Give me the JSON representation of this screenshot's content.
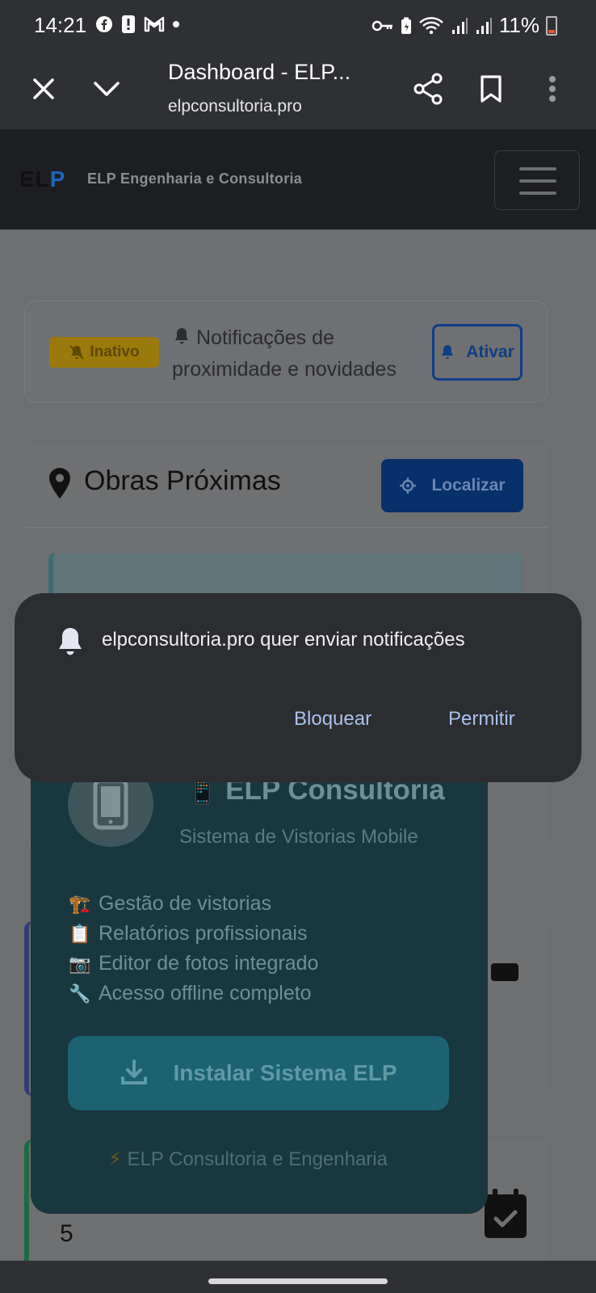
{
  "status_bar": {
    "time": "14:21",
    "battery": "11%",
    "icons_left": [
      "facebook-icon",
      "alert-icon",
      "gmail-icon",
      "dot-icon"
    ],
    "icons_right": [
      "key-icon",
      "battery-saver-icon",
      "wifi-icon",
      "signal-icon",
      "signal-icon"
    ]
  },
  "browser": {
    "title": "Dashboard - ELP...",
    "url": "elpconsultoria.pro"
  },
  "navbar": {
    "logo_text_dark": "EL",
    "logo_text_blue": "P",
    "brand_name": "ELP Engenharia e Consultoria"
  },
  "notifications_card": {
    "status_badge": "Inativo",
    "text": "Notificações de proximidade e novidades",
    "button": "Ativar"
  },
  "obras_card": {
    "title": "Obras Próximas",
    "locate_button": "Localizar"
  },
  "stats": {
    "green_card_number": "5"
  },
  "install_banner": {
    "title": "ELP Consultoria",
    "subtitle": "Sistema de Vistorias Mobile",
    "features": [
      {
        "icon": "🏗️",
        "text": "Gestão de vistorias"
      },
      {
        "icon": "📋",
        "text": "Relatórios profissionais"
      },
      {
        "icon": "📷",
        "text": "Editor de fotos integrado"
      },
      {
        "icon": "🔧",
        "text": "Acesso offline completo"
      }
    ],
    "install_button": "Instalar Sistema ELP",
    "footer": "ELP Consultoria e Engenharia"
  },
  "permission_dialog": {
    "message": "elpconsultoria.pro quer enviar notificações",
    "block": "Bloquear",
    "allow": "Permitir"
  },
  "colors": {
    "accent_blue": "#1b66b8",
    "dialog_button": "#a9c2ee",
    "dialog_bg": "#2c2d31"
  }
}
